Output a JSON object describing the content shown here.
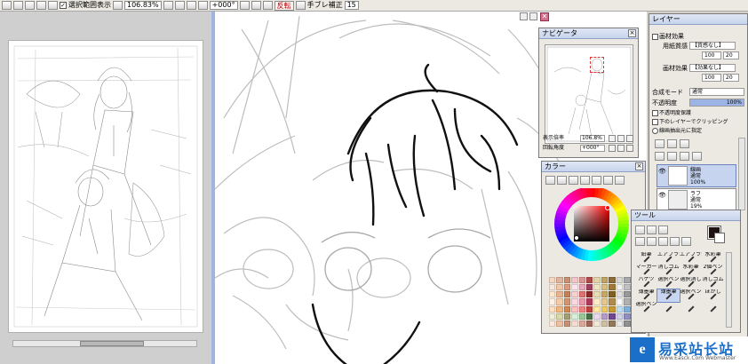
{
  "toolbar": {
    "check_label": "選択範囲表示",
    "zoom_value": "106.83%",
    "rotation_value": "+000°",
    "flip_label": "反転",
    "stabilizer_label": "手ブレ補正",
    "stabilizer_value": "15"
  },
  "navigator": {
    "title": "ナビゲータ",
    "zoom_label": "表示倍率",
    "zoom_value": "106.8%",
    "angle_label": "回転角度",
    "angle_value": "+000°"
  },
  "color_panel": {
    "title": "カラー",
    "primary_color": "#b0272a",
    "swatches": [
      "#f4d8c4",
      "#e0b49a",
      "#c8906e",
      "#f2c6c8",
      "#d99494",
      "#b04a4a",
      "#e3d4a8",
      "#c2a462",
      "#8c6c3a",
      "#d8d8d8",
      "#a8a8a8",
      "#686868",
      "#f8e8dc",
      "#f0c8a8",
      "#dc9c7c",
      "#fce4ec",
      "#e8a8b8",
      "#a04060",
      "#f0e4c0",
      "#d8c07c",
      "#a07838",
      "#f0f0f0",
      "#c0c0c0",
      "#404040",
      "#ffe8d0",
      "#e8b490",
      "#c48058",
      "#f8d0d0",
      "#e07070",
      "#902828",
      "#e8dcb0",
      "#c8a85c",
      "#806020",
      "#e0e0e0",
      "#989898",
      "#202020",
      "#fff0e4",
      "#f4cca8",
      "#d49470",
      "#fad8e0",
      "#e898a8",
      "#b03858",
      "#fcecc8",
      "#e4c88c",
      "#b08c4c",
      "#f8f8f8",
      "#b0b0b0",
      "#000000",
      "#ffe0c0",
      "#f0b880",
      "#d08850",
      "#ffc0c0",
      "#f08080",
      "#c04040",
      "#ffe8a0",
      "#f0c860",
      "#c89830",
      "#c0e0f0",
      "#80b0d8",
      "#305880",
      "#f0f0d8",
      "#d8d8a8",
      "#a0a070",
      "#d8f0d8",
      "#98c898",
      "#487048",
      "#e8d8f0",
      "#b898d0",
      "#704890",
      "#d0d0e8",
      "#9090c0",
      "#383868",
      "#fce8dc",
      "#ecc0a0",
      "#c89070",
      "#f4dcd0",
      "#dca898",
      "#a06858",
      "#f0e8d8",
      "#d0c0a0",
      "#907858",
      "#e8e8e8",
      "#909090",
      "#505050"
    ]
  },
  "layer_panel": {
    "title": "レイヤー",
    "paper_effect_header": "画材効果",
    "paper_texture_label": "用紙質感",
    "paper_texture_value": "【質感なし】",
    "paper_texture_values": [
      "100",
      "20"
    ],
    "brush_effect_label": "画材効果",
    "brush_effect_value": "【効果なし】",
    "brush_effect_values": [
      "100",
      "20"
    ],
    "blend_mode_label": "合成モード",
    "blend_mode_value": "通常",
    "opacity_label": "不透明度",
    "opacity_value": "100%",
    "protect_alpha": "不透明度保護",
    "clip_below": "下のレイヤーでクリッピング",
    "selection_source": "線画抽出元に指定",
    "layers": [
      {
        "name": "線画",
        "mode": "通常",
        "opacity": "100%"
      },
      {
        "name": "ラフ",
        "mode": "通常",
        "opacity": "19%"
      }
    ]
  },
  "tool_panel": {
    "title": "ツール",
    "foreground_color": "#1e1212",
    "tools": [
      "鉛筆",
      "エアブラシ",
      "エアブラシ",
      "水彩筆",
      "マーカー",
      "消しゴム",
      "水彩筆",
      "2値ペン",
      "バケツ",
      "選択ペン",
      "選択消し",
      "消しゴム",
      "薄墨筆",
      "薄墨筆",
      "選択ペン",
      "ぼかし",
      "選択ペン",
      "",
      "",
      ""
    ]
  },
  "watermark": {
    "logo_letter": "e",
    "title": "易采站长站",
    "subtitle": "Www.Easck.Com  Webmaster"
  }
}
